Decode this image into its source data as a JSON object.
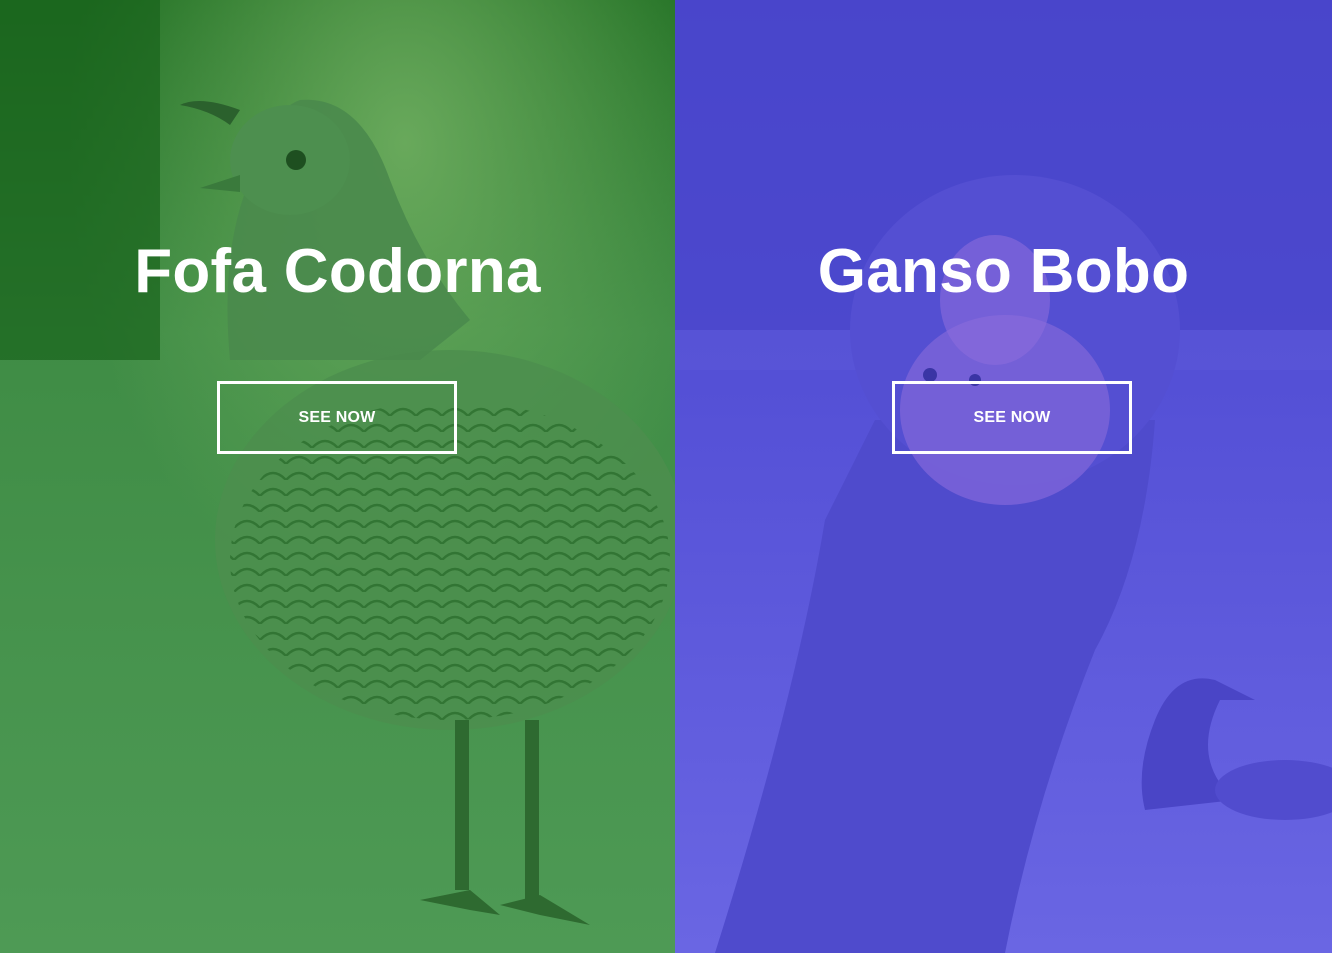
{
  "panels": [
    {
      "title": "Fofa Codorna",
      "button_label": "SEE NOW",
      "overlay_color": "#2f8f2f",
      "image_subject": "quail"
    },
    {
      "title": "Ganso Bobo",
      "button_label": "SEE NOW",
      "overlay_color": "#5a54d9",
      "image_subject": "goose"
    }
  ]
}
